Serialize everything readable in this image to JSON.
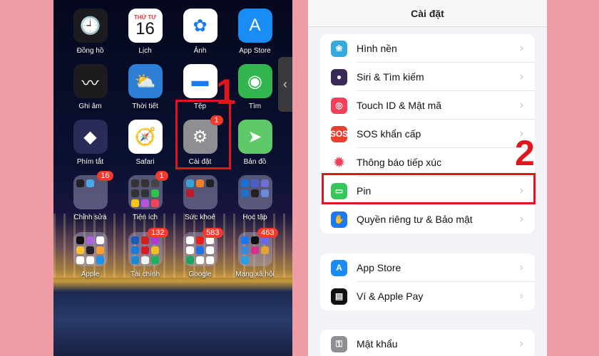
{
  "home": {
    "apps": [
      {
        "label": "Đồng hồ",
        "icon": "clock-icon",
        "glyph": "🕘",
        "bg": "#1c1c1e"
      },
      {
        "label": "Lịch",
        "icon": "calendar-icon",
        "day": "THỨ TƯ",
        "date": "16",
        "bg": "#ffffff"
      },
      {
        "label": "Ảnh",
        "icon": "photos-icon",
        "glyph": "✿",
        "bg": "#ffffff"
      },
      {
        "label": "App Store",
        "icon": "app-store-icon",
        "glyph": "A",
        "bg": "#1a8cf5"
      },
      {
        "label": "Ghi âm",
        "icon": "voice-memos-icon",
        "glyph": "〰",
        "bg": "#1c1c1e"
      },
      {
        "label": "Thời tiết",
        "icon": "weather-icon",
        "glyph": "⛅",
        "bg": "#2d7fd6"
      },
      {
        "label": "Tệp",
        "icon": "files-icon",
        "glyph": "▬",
        "bg": "#ffffff"
      },
      {
        "label": "Tìm",
        "icon": "find-my-icon",
        "glyph": "◉",
        "bg": "#34b54f"
      },
      {
        "label": "Phím tắt",
        "icon": "shortcuts-icon",
        "glyph": "◆",
        "bg": "#2b2b5a"
      },
      {
        "label": "Safari",
        "icon": "safari-icon",
        "glyph": "🧭",
        "bg": "#ffffff"
      },
      {
        "label": "Cài đặt",
        "icon": "settings-gear-icon",
        "glyph": "⚙",
        "bg": "#8e8e93",
        "badge": "1"
      },
      {
        "label": "Bản đồ",
        "icon": "maps-icon",
        "glyph": "➤",
        "bg": "#5fc96a"
      }
    ],
    "folders": [
      {
        "label": "Chỉnh sửa",
        "badge": "16",
        "colors": [
          "#222",
          "#4aa8e8"
        ]
      },
      {
        "label": "Tiện ích",
        "badge": "1",
        "colors": [
          "#333",
          "#333",
          "#444",
          "#333",
          "#333",
          "#2fc24b",
          "#f5c518",
          "#b455e0",
          "#f04356"
        ]
      },
      {
        "label": "Sức khoẻ",
        "colors": [
          "#3aa0d8",
          "#f08020",
          "#222",
          "#c0182a"
        ]
      },
      {
        "label": "Học tập",
        "colors": [
          "#1a6fd8",
          "#4a60c8",
          "#6a70d8",
          "#1e70c8",
          "#222",
          "#6a8ad8"
        ]
      },
      {
        "label": "Apple",
        "colors": [
          "#111",
          "#b060e0",
          "#fff",
          "#f8c030",
          "#222",
          "#f8a030",
          "#fff",
          "#fff",
          "#1e90f0"
        ]
      },
      {
        "label": "Tài chính",
        "badge": "132",
        "colors": [
          "#1a5ab8",
          "#d02020",
          "#b03ad0",
          "#1a7ad8",
          "#d81a2a",
          "#f0c020",
          "#1a8ad8",
          "#f0f0f0",
          "#20b060"
        ]
      },
      {
        "label": "Google",
        "badge": "583",
        "colors": [
          "#fff",
          "#f01a1a",
          "#fff",
          "#fff",
          "#1a73e8",
          "#fff",
          "#1ea362",
          "#fff",
          "#fff"
        ]
      },
      {
        "label": "Mạng xã hội",
        "badge": "463",
        "colors": [
          "#1877f2",
          "#111",
          "#6a6af0",
          "#3a8ad8",
          "#d8308a",
          "#e8a030",
          "#2aa0e0"
        ]
      }
    ],
    "handle_glyph": "‹",
    "step": "1"
  },
  "settings": {
    "title": "Cài đặt",
    "groups": [
      [
        {
          "label": "Hình nền",
          "icon": "wallpaper-icon",
          "glyph": "❀",
          "color": "#35aadc"
        },
        {
          "label": "Siri & Tìm kiếm",
          "icon": "siri-icon",
          "glyph": "●",
          "color": "#3a2a5a"
        },
        {
          "label": "Touch ID & Mật mã",
          "icon": "fingerprint-icon",
          "glyph": "◎",
          "color": "#f0405a"
        },
        {
          "label": "SOS khẩn cấp",
          "icon": "sos-icon",
          "glyph": "SOS",
          "color": "#e8402e"
        },
        {
          "label": "Thông báo tiếp xúc",
          "icon": "exposure-notification-icon",
          "glyph": "✹",
          "color": "#ffffff"
        },
        {
          "label": "Pin",
          "icon": "battery-icon",
          "glyph": "▭",
          "color": "#34c759"
        },
        {
          "label": "Quyền riêng tư & Bảo mật",
          "icon": "privacy-hand-icon",
          "glyph": "✋",
          "color": "#1a7af0"
        }
      ],
      [
        {
          "label": "App Store",
          "icon": "app-store-icon",
          "glyph": "A",
          "color": "#1a8cf5"
        },
        {
          "label": "Ví & Apple Pay",
          "icon": "wallet-icon",
          "glyph": "▤",
          "color": "#111111"
        }
      ],
      [
        {
          "label": "Mật khẩu",
          "icon": "key-icon",
          "glyph": "⚿",
          "color": "#8e8e93"
        }
      ]
    ],
    "chevron": "›",
    "step": "2"
  },
  "colors": {
    "highlight": "#e0161e",
    "background": "#ef9ca4"
  }
}
